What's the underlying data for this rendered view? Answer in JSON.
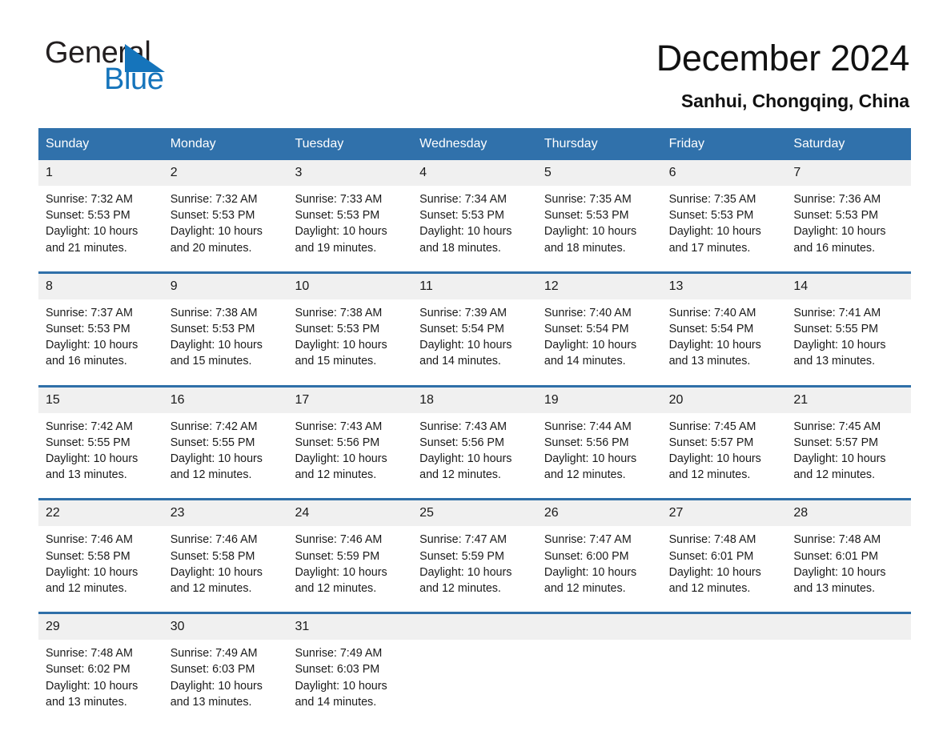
{
  "logo": {
    "word_one": "General",
    "word_two": "Blue",
    "triangle_color": "#1574bb",
    "text_color": "#231f20"
  },
  "header": {
    "month_title": "December 2024",
    "location": "Sanhui, Chongqing, China"
  },
  "theme": {
    "header_blue": "#3071ab",
    "row_border_blue": "#2f6fa8",
    "daynum_band": "#f0f0f0"
  },
  "calendar": {
    "weekday_headers": [
      "Sunday",
      "Monday",
      "Tuesday",
      "Wednesday",
      "Thursday",
      "Friday",
      "Saturday"
    ],
    "weeks": [
      [
        {
          "day": "1",
          "sunrise": "Sunrise: 7:32 AM",
          "sunset": "Sunset: 5:53 PM",
          "daylight_line1": "Daylight: 10 hours",
          "daylight_line2": "and 21 minutes."
        },
        {
          "day": "2",
          "sunrise": "Sunrise: 7:32 AM",
          "sunset": "Sunset: 5:53 PM",
          "daylight_line1": "Daylight: 10 hours",
          "daylight_line2": "and 20 minutes."
        },
        {
          "day": "3",
          "sunrise": "Sunrise: 7:33 AM",
          "sunset": "Sunset: 5:53 PM",
          "daylight_line1": "Daylight: 10 hours",
          "daylight_line2": "and 19 minutes."
        },
        {
          "day": "4",
          "sunrise": "Sunrise: 7:34 AM",
          "sunset": "Sunset: 5:53 PM",
          "daylight_line1": "Daylight: 10 hours",
          "daylight_line2": "and 18 minutes."
        },
        {
          "day": "5",
          "sunrise": "Sunrise: 7:35 AM",
          "sunset": "Sunset: 5:53 PM",
          "daylight_line1": "Daylight: 10 hours",
          "daylight_line2": "and 18 minutes."
        },
        {
          "day": "6",
          "sunrise": "Sunrise: 7:35 AM",
          "sunset": "Sunset: 5:53 PM",
          "daylight_line1": "Daylight: 10 hours",
          "daylight_line2": "and 17 minutes."
        },
        {
          "day": "7",
          "sunrise": "Sunrise: 7:36 AM",
          "sunset": "Sunset: 5:53 PM",
          "daylight_line1": "Daylight: 10 hours",
          "daylight_line2": "and 16 minutes."
        }
      ],
      [
        {
          "day": "8",
          "sunrise": "Sunrise: 7:37 AM",
          "sunset": "Sunset: 5:53 PM",
          "daylight_line1": "Daylight: 10 hours",
          "daylight_line2": "and 16 minutes."
        },
        {
          "day": "9",
          "sunrise": "Sunrise: 7:38 AM",
          "sunset": "Sunset: 5:53 PM",
          "daylight_line1": "Daylight: 10 hours",
          "daylight_line2": "and 15 minutes."
        },
        {
          "day": "10",
          "sunrise": "Sunrise: 7:38 AM",
          "sunset": "Sunset: 5:53 PM",
          "daylight_line1": "Daylight: 10 hours",
          "daylight_line2": "and 15 minutes."
        },
        {
          "day": "11",
          "sunrise": "Sunrise: 7:39 AM",
          "sunset": "Sunset: 5:54 PM",
          "daylight_line1": "Daylight: 10 hours",
          "daylight_line2": "and 14 minutes."
        },
        {
          "day": "12",
          "sunrise": "Sunrise: 7:40 AM",
          "sunset": "Sunset: 5:54 PM",
          "daylight_line1": "Daylight: 10 hours",
          "daylight_line2": "and 14 minutes."
        },
        {
          "day": "13",
          "sunrise": "Sunrise: 7:40 AM",
          "sunset": "Sunset: 5:54 PM",
          "daylight_line1": "Daylight: 10 hours",
          "daylight_line2": "and 13 minutes."
        },
        {
          "day": "14",
          "sunrise": "Sunrise: 7:41 AM",
          "sunset": "Sunset: 5:55 PM",
          "daylight_line1": "Daylight: 10 hours",
          "daylight_line2": "and 13 minutes."
        }
      ],
      [
        {
          "day": "15",
          "sunrise": "Sunrise: 7:42 AM",
          "sunset": "Sunset: 5:55 PM",
          "daylight_line1": "Daylight: 10 hours",
          "daylight_line2": "and 13 minutes."
        },
        {
          "day": "16",
          "sunrise": "Sunrise: 7:42 AM",
          "sunset": "Sunset: 5:55 PM",
          "daylight_line1": "Daylight: 10 hours",
          "daylight_line2": "and 12 minutes."
        },
        {
          "day": "17",
          "sunrise": "Sunrise: 7:43 AM",
          "sunset": "Sunset: 5:56 PM",
          "daylight_line1": "Daylight: 10 hours",
          "daylight_line2": "and 12 minutes."
        },
        {
          "day": "18",
          "sunrise": "Sunrise: 7:43 AM",
          "sunset": "Sunset: 5:56 PM",
          "daylight_line1": "Daylight: 10 hours",
          "daylight_line2": "and 12 minutes."
        },
        {
          "day": "19",
          "sunrise": "Sunrise: 7:44 AM",
          "sunset": "Sunset: 5:56 PM",
          "daylight_line1": "Daylight: 10 hours",
          "daylight_line2": "and 12 minutes."
        },
        {
          "day": "20",
          "sunrise": "Sunrise: 7:45 AM",
          "sunset": "Sunset: 5:57 PM",
          "daylight_line1": "Daylight: 10 hours",
          "daylight_line2": "and 12 minutes."
        },
        {
          "day": "21",
          "sunrise": "Sunrise: 7:45 AM",
          "sunset": "Sunset: 5:57 PM",
          "daylight_line1": "Daylight: 10 hours",
          "daylight_line2": "and 12 minutes."
        }
      ],
      [
        {
          "day": "22",
          "sunrise": "Sunrise: 7:46 AM",
          "sunset": "Sunset: 5:58 PM",
          "daylight_line1": "Daylight: 10 hours",
          "daylight_line2": "and 12 minutes."
        },
        {
          "day": "23",
          "sunrise": "Sunrise: 7:46 AM",
          "sunset": "Sunset: 5:58 PM",
          "daylight_line1": "Daylight: 10 hours",
          "daylight_line2": "and 12 minutes."
        },
        {
          "day": "24",
          "sunrise": "Sunrise: 7:46 AM",
          "sunset": "Sunset: 5:59 PM",
          "daylight_line1": "Daylight: 10 hours",
          "daylight_line2": "and 12 minutes."
        },
        {
          "day": "25",
          "sunrise": "Sunrise: 7:47 AM",
          "sunset": "Sunset: 5:59 PM",
          "daylight_line1": "Daylight: 10 hours",
          "daylight_line2": "and 12 minutes."
        },
        {
          "day": "26",
          "sunrise": "Sunrise: 7:47 AM",
          "sunset": "Sunset: 6:00 PM",
          "daylight_line1": "Daylight: 10 hours",
          "daylight_line2": "and 12 minutes."
        },
        {
          "day": "27",
          "sunrise": "Sunrise: 7:48 AM",
          "sunset": "Sunset: 6:01 PM",
          "daylight_line1": "Daylight: 10 hours",
          "daylight_line2": "and 12 minutes."
        },
        {
          "day": "28",
          "sunrise": "Sunrise: 7:48 AM",
          "sunset": "Sunset: 6:01 PM",
          "daylight_line1": "Daylight: 10 hours",
          "daylight_line2": "and 13 minutes."
        }
      ],
      [
        {
          "day": "29",
          "sunrise": "Sunrise: 7:48 AM",
          "sunset": "Sunset: 6:02 PM",
          "daylight_line1": "Daylight: 10 hours",
          "daylight_line2": "and 13 minutes."
        },
        {
          "day": "30",
          "sunrise": "Sunrise: 7:49 AM",
          "sunset": "Sunset: 6:03 PM",
          "daylight_line1": "Daylight: 10 hours",
          "daylight_line2": "and 13 minutes."
        },
        {
          "day": "31",
          "sunrise": "Sunrise: 7:49 AM",
          "sunset": "Sunset: 6:03 PM",
          "daylight_line1": "Daylight: 10 hours",
          "daylight_line2": "and 14 minutes."
        },
        {
          "day": "",
          "sunrise": "",
          "sunset": "",
          "daylight_line1": "",
          "daylight_line2": ""
        },
        {
          "day": "",
          "sunrise": "",
          "sunset": "",
          "daylight_line1": "",
          "daylight_line2": ""
        },
        {
          "day": "",
          "sunrise": "",
          "sunset": "",
          "daylight_line1": "",
          "daylight_line2": ""
        },
        {
          "day": "",
          "sunrise": "",
          "sunset": "",
          "daylight_line1": "",
          "daylight_line2": ""
        }
      ]
    ]
  }
}
